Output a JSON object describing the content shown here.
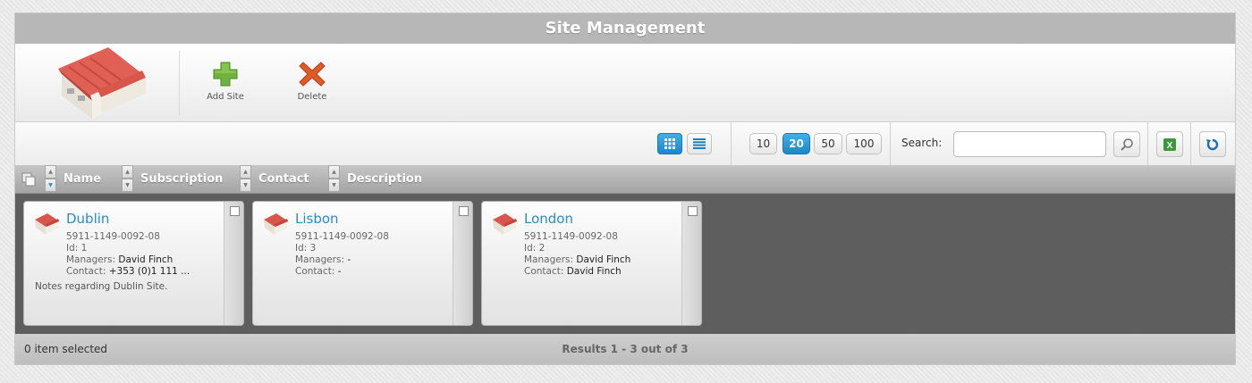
{
  "window": {
    "title": "Site Management"
  },
  "toolbar": {
    "logo_icon": "warehouse-icon",
    "add_label": "Add Site",
    "add_icon": "plus-icon",
    "delete_label": "Delete",
    "delete_icon": "x-icon"
  },
  "view": {
    "grid_icon": "grid-view-icon",
    "list_icon": "list-view-icon",
    "active": "grid"
  },
  "paging": {
    "sizes": [
      "10",
      "20",
      "50",
      "100"
    ],
    "active": "20"
  },
  "search": {
    "label": "Search:",
    "value": "",
    "placeholder": ""
  },
  "actions": {
    "search_icon": "magnifier-icon",
    "export_icon": "excel-icon",
    "refresh_icon": "refresh-icon"
  },
  "columns": [
    "Name",
    "Subscription",
    "Contact",
    "Description"
  ],
  "sites": [
    {
      "name": "Dublin",
      "subscription": "5911-1149-0092-08",
      "id_label": "Id:",
      "id": "1",
      "managers_label": "Managers:",
      "managers": "David Finch",
      "contact_label": "Contact:",
      "contact": "+353 (0)1 111 ...",
      "notes": "Notes regarding Dublin Site."
    },
    {
      "name": "Lisbon",
      "subscription": "5911-1149-0092-08",
      "id_label": "Id:",
      "id": "3",
      "managers_label": "Managers:",
      "managers": "-",
      "contact_label": "Contact:",
      "contact": "-",
      "notes": ""
    },
    {
      "name": "London",
      "subscription": "5911-1149-0092-08",
      "id_label": "Id:",
      "id": "2",
      "managers_label": "Managers:",
      "managers": "David Finch",
      "contact_label": "Contact:",
      "contact": "David Finch",
      "notes": ""
    }
  ],
  "status": {
    "selected": "0 item selected",
    "results": "Results 1 - 3 out of 3"
  },
  "colors": {
    "accent": "#2b8cc4",
    "active_button": "#1d86c9",
    "content_bg": "#5e5e5e"
  }
}
